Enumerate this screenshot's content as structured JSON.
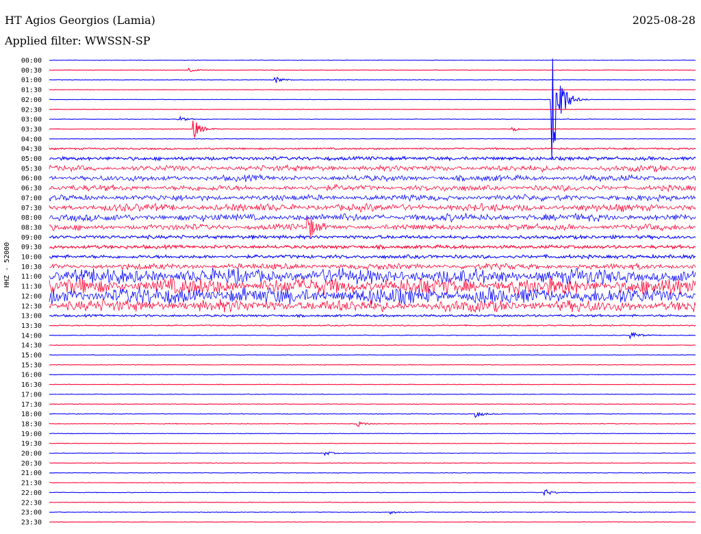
{
  "header": {
    "title": "HT Agios Georgios (Lamia)",
    "date": "2025-08-28",
    "filter": "Applied filter: WWSSN-SP"
  },
  "chart_data": {
    "type": "line",
    "ylabel": "HHZ - 52000",
    "row_labels": [
      "00:00",
      "00:30",
      "01:00",
      "01:30",
      "02:00",
      "02:30",
      "03:00",
      "03:30",
      "04:00",
      "04:30",
      "05:00",
      "05:30",
      "06:00",
      "06:30",
      "07:00",
      "07:30",
      "08:00",
      "08:30",
      "09:00",
      "09:30",
      "10:00",
      "10:30",
      "11:00",
      "11:30",
      "12:00",
      "12:30",
      "13:00",
      "13:30",
      "14:00",
      "14:30",
      "15:00",
      "15:30",
      "16:00",
      "16:30",
      "17:00",
      "17:30",
      "18:00",
      "18:30",
      "19:00",
      "19:30",
      "20:00",
      "20:30",
      "21:00",
      "21:30",
      "22:00",
      "22:30",
      "23:00",
      "23:30"
    ],
    "trace_colors": [
      "#0000ff",
      "#ff0033"
    ],
    "noise_level": [
      0.4,
      0.4,
      0.4,
      0.4,
      0.4,
      0.4,
      0.5,
      0.5,
      0.5,
      1.5,
      3,
      4,
      4,
      4,
      4,
      5,
      5,
      4,
      3,
      3,
      3,
      4,
      10,
      11,
      11,
      8,
      2,
      1,
      0.6,
      0.5,
      0.5,
      0.5,
      0.5,
      0.5,
      0.5,
      0.5,
      0.6,
      0.6,
      0.5,
      0.5,
      0.5,
      0.5,
      0.5,
      0.5,
      0.5,
      0.5,
      0.5,
      0.5
    ],
    "events": [
      {
        "row": 1,
        "minute": 6.5,
        "amplitude": 3
      },
      {
        "row": 2,
        "minute": 10.5,
        "amplitude": 5
      },
      {
        "row": 6,
        "minute": 6.0,
        "amplitude": 4
      },
      {
        "row": 7,
        "minute": 6.7,
        "amplitude": 14
      },
      {
        "row": 7,
        "minute": 21.5,
        "amplitude": 3
      },
      {
        "row": 4,
        "minute": 23.3,
        "amplitude": 140
      },
      {
        "row": 17,
        "minute": 12.0,
        "amplitude": 18
      },
      {
        "row": 28,
        "minute": 27.0,
        "amplitude": 6
      },
      {
        "row": 36,
        "minute": 19.8,
        "amplitude": 5
      },
      {
        "row": 37,
        "minute": 14.3,
        "amplitude": 4
      },
      {
        "row": 40,
        "minute": 12.8,
        "amplitude": 3
      },
      {
        "row": 44,
        "minute": 23.0,
        "amplitude": 5
      },
      {
        "row": 46,
        "minute": 15.8,
        "amplitude": 3
      }
    ]
  }
}
